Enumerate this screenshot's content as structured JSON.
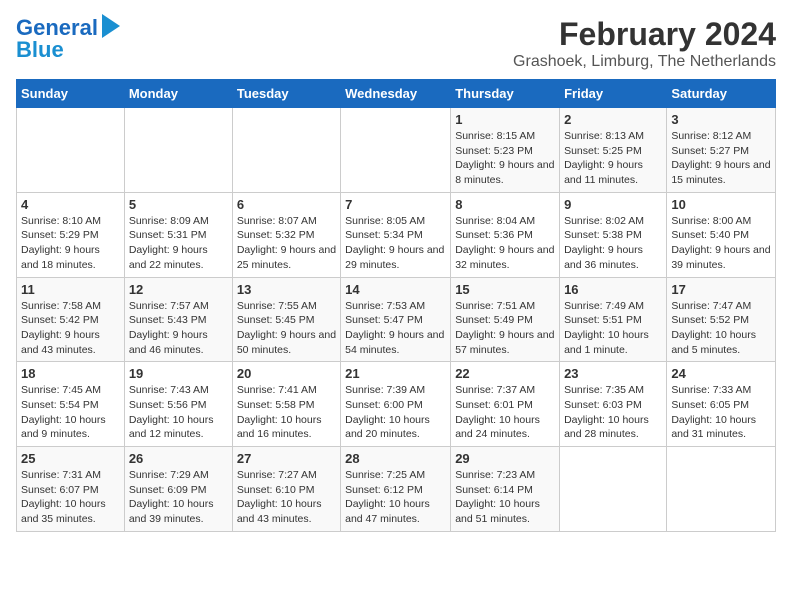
{
  "app": {
    "logo_line1": "General",
    "logo_line2": "Blue"
  },
  "header": {
    "title": "February 2024",
    "subtitle": "Grashoek, Limburg, The Netherlands"
  },
  "calendar": {
    "columns": [
      "Sunday",
      "Monday",
      "Tuesday",
      "Wednesday",
      "Thursday",
      "Friday",
      "Saturday"
    ],
    "weeks": [
      [
        {
          "day": "",
          "content": ""
        },
        {
          "day": "",
          "content": ""
        },
        {
          "day": "",
          "content": ""
        },
        {
          "day": "",
          "content": ""
        },
        {
          "day": "1",
          "content": "Sunrise: 8:15 AM\nSunset: 5:23 PM\nDaylight: 9 hours\nand 8 minutes."
        },
        {
          "day": "2",
          "content": "Sunrise: 8:13 AM\nSunset: 5:25 PM\nDaylight: 9 hours\nand 11 minutes."
        },
        {
          "day": "3",
          "content": "Sunrise: 8:12 AM\nSunset: 5:27 PM\nDaylight: 9 hours\nand 15 minutes."
        }
      ],
      [
        {
          "day": "4",
          "content": "Sunrise: 8:10 AM\nSunset: 5:29 PM\nDaylight: 9 hours\nand 18 minutes."
        },
        {
          "day": "5",
          "content": "Sunrise: 8:09 AM\nSunset: 5:31 PM\nDaylight: 9 hours\nand 22 minutes."
        },
        {
          "day": "6",
          "content": "Sunrise: 8:07 AM\nSunset: 5:32 PM\nDaylight: 9 hours\nand 25 minutes."
        },
        {
          "day": "7",
          "content": "Sunrise: 8:05 AM\nSunset: 5:34 PM\nDaylight: 9 hours\nand 29 minutes."
        },
        {
          "day": "8",
          "content": "Sunrise: 8:04 AM\nSunset: 5:36 PM\nDaylight: 9 hours\nand 32 minutes."
        },
        {
          "day": "9",
          "content": "Sunrise: 8:02 AM\nSunset: 5:38 PM\nDaylight: 9 hours\nand 36 minutes."
        },
        {
          "day": "10",
          "content": "Sunrise: 8:00 AM\nSunset: 5:40 PM\nDaylight: 9 hours\nand 39 minutes."
        }
      ],
      [
        {
          "day": "11",
          "content": "Sunrise: 7:58 AM\nSunset: 5:42 PM\nDaylight: 9 hours\nand 43 minutes."
        },
        {
          "day": "12",
          "content": "Sunrise: 7:57 AM\nSunset: 5:43 PM\nDaylight: 9 hours\nand 46 minutes."
        },
        {
          "day": "13",
          "content": "Sunrise: 7:55 AM\nSunset: 5:45 PM\nDaylight: 9 hours\nand 50 minutes."
        },
        {
          "day": "14",
          "content": "Sunrise: 7:53 AM\nSunset: 5:47 PM\nDaylight: 9 hours\nand 54 minutes."
        },
        {
          "day": "15",
          "content": "Sunrise: 7:51 AM\nSunset: 5:49 PM\nDaylight: 9 hours\nand 57 minutes."
        },
        {
          "day": "16",
          "content": "Sunrise: 7:49 AM\nSunset: 5:51 PM\nDaylight: 10 hours\nand 1 minute."
        },
        {
          "day": "17",
          "content": "Sunrise: 7:47 AM\nSunset: 5:52 PM\nDaylight: 10 hours\nand 5 minutes."
        }
      ],
      [
        {
          "day": "18",
          "content": "Sunrise: 7:45 AM\nSunset: 5:54 PM\nDaylight: 10 hours\nand 9 minutes."
        },
        {
          "day": "19",
          "content": "Sunrise: 7:43 AM\nSunset: 5:56 PM\nDaylight: 10 hours\nand 12 minutes."
        },
        {
          "day": "20",
          "content": "Sunrise: 7:41 AM\nSunset: 5:58 PM\nDaylight: 10 hours\nand 16 minutes."
        },
        {
          "day": "21",
          "content": "Sunrise: 7:39 AM\nSunset: 6:00 PM\nDaylight: 10 hours\nand 20 minutes."
        },
        {
          "day": "22",
          "content": "Sunrise: 7:37 AM\nSunset: 6:01 PM\nDaylight: 10 hours\nand 24 minutes."
        },
        {
          "day": "23",
          "content": "Sunrise: 7:35 AM\nSunset: 6:03 PM\nDaylight: 10 hours\nand 28 minutes."
        },
        {
          "day": "24",
          "content": "Sunrise: 7:33 AM\nSunset: 6:05 PM\nDaylight: 10 hours\nand 31 minutes."
        }
      ],
      [
        {
          "day": "25",
          "content": "Sunrise: 7:31 AM\nSunset: 6:07 PM\nDaylight: 10 hours\nand 35 minutes."
        },
        {
          "day": "26",
          "content": "Sunrise: 7:29 AM\nSunset: 6:09 PM\nDaylight: 10 hours\nand 39 minutes."
        },
        {
          "day": "27",
          "content": "Sunrise: 7:27 AM\nSunset: 6:10 PM\nDaylight: 10 hours\nand 43 minutes."
        },
        {
          "day": "28",
          "content": "Sunrise: 7:25 AM\nSunset: 6:12 PM\nDaylight: 10 hours\nand 47 minutes."
        },
        {
          "day": "29",
          "content": "Sunrise: 7:23 AM\nSunset: 6:14 PM\nDaylight: 10 hours\nand 51 minutes."
        },
        {
          "day": "",
          "content": ""
        },
        {
          "day": "",
          "content": ""
        }
      ]
    ]
  }
}
